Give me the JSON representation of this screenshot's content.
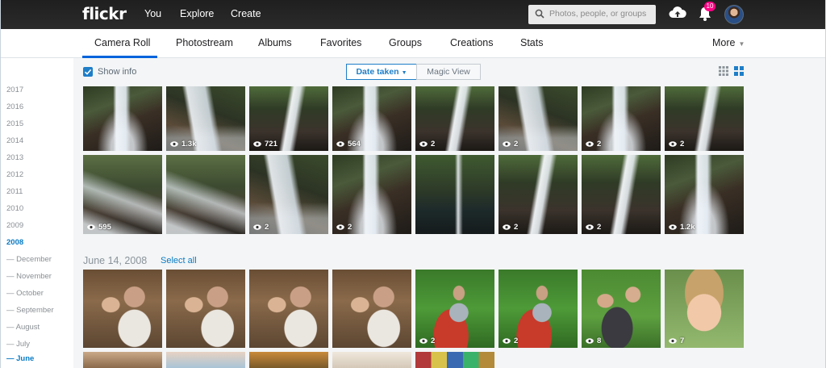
{
  "topbar": {
    "logo": "flickr",
    "nav": [
      "You",
      "Explore",
      "Create"
    ],
    "search_placeholder": "Photos, people, or groups",
    "notification_count": "10"
  },
  "subnav": {
    "tabs": [
      "Camera Roll",
      "Photostream",
      "Albums",
      "Favorites",
      "Groups",
      "Creations",
      "Stats"
    ],
    "active_tab": "Camera Roll",
    "more_label": "More"
  },
  "toolbar": {
    "show_info_label": "Show info",
    "date_taken_label": "Date taken",
    "magic_view_label": "Magic View"
  },
  "timeline": {
    "years": [
      "2017",
      "2016",
      "2015",
      "2014",
      "2013",
      "2012",
      "2011",
      "2010",
      "2009",
      "2008"
    ],
    "selected_year": "2008",
    "months": [
      "— December",
      "— November",
      "— October",
      "— September",
      "— August",
      "— July",
      "— June"
    ],
    "selected_month": "— June"
  },
  "photos_row1_counts": [
    "",
    "1.3k",
    "721",
    "564",
    "2",
    "2",
    "2",
    "2"
  ],
  "photos_row2_counts": [
    "595",
    "",
    "2",
    "2",
    "",
    "2",
    "2",
    "1.2k"
  ],
  "section": {
    "date": "June 14, 2008",
    "select_all": "Select all"
  },
  "photos_row3_counts": [
    "",
    "",
    "",
    "",
    "2",
    "2",
    "8",
    "7"
  ],
  "colors": {
    "accent": "#0063dc",
    "link": "#0a7bc4",
    "badge": "#ff0084"
  }
}
